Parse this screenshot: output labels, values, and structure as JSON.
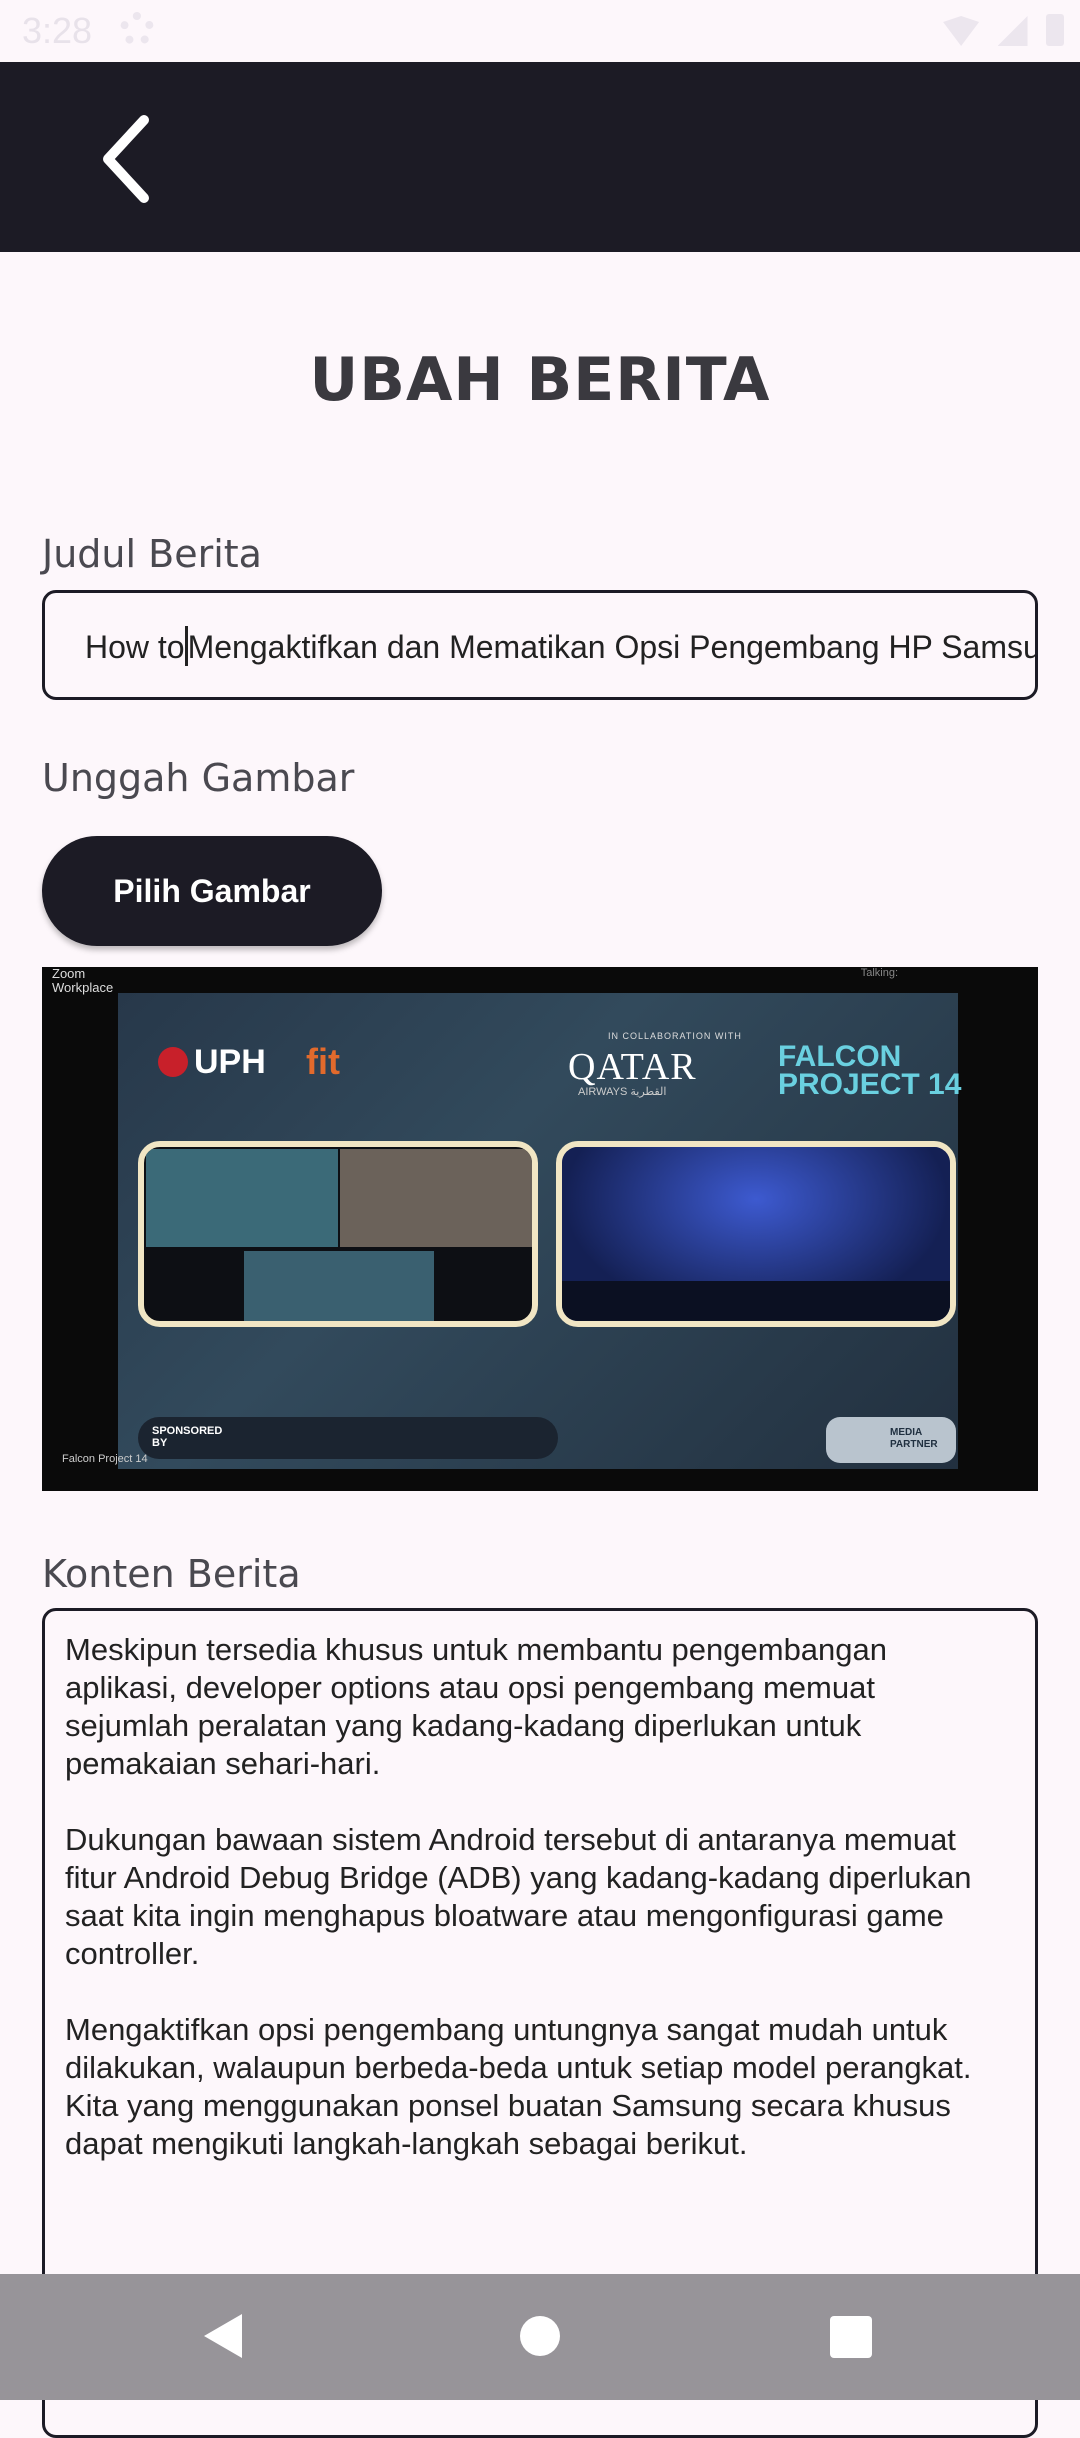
{
  "status_bar": {
    "time": "3:28"
  },
  "app_bar": {
    "back_icon": "chevron-left-icon"
  },
  "page": {
    "title": "UBAH BERITA"
  },
  "form": {
    "title_label": "Judul Berita",
    "title_value_before_cursor": "How to",
    "title_value_after_cursor": "Mengaktifkan dan Mematikan Opsi Pengembang HP Samsung",
    "image_label": "Unggah Gambar",
    "pick_image_button": "Pilih Gambar",
    "content_label": "Konten Berita",
    "content_value": "Meskipun tersedia khusus untuk membantu pengembangan\naplikasi, developer options atau opsi pengembang memuat\nsejumlah peralatan yang kadang-kadang diperlukan untuk\npemakaian sehari-hari.\n\nDukungan bawaan sistem Android tersebut di antaranya memuat\nfitur Android Debug Bridge (ADB) yang kadang-kadang diperlukan\nsaat kita ingin menghapus bloatware atau mengonfigurasi game\ncontroller.\n\nMengaktifkan opsi pengembang untungnya sangat mudah untuk\ndilakukan, walaupun berbeda-beda untuk setiap model perangkat.\nKita yang menggunakan ponsel buatan Samsung secara khusus\ndapat mengikuti langkah-langkah sebagai berikut."
  },
  "preview": {
    "corner_text": "Zoom\nWorkplace",
    "talking_text": "Talking:",
    "uph": "UPH",
    "fit": "fit",
    "collab": "IN COLLABORATION WITH",
    "qatar": "QATAR",
    "qatar_sub": "AIRWAYS القطرية",
    "falcon": "FALCON\nPROJECT 14",
    "sponsored": "SPONSORED\nBY",
    "media_partner": "MEDIA\nPARTNER",
    "footer": "Falcon Project 14"
  },
  "nav_bar": {
    "back": "nav-back-icon",
    "home": "nav-home-icon",
    "recents": "nav-recents-icon"
  }
}
